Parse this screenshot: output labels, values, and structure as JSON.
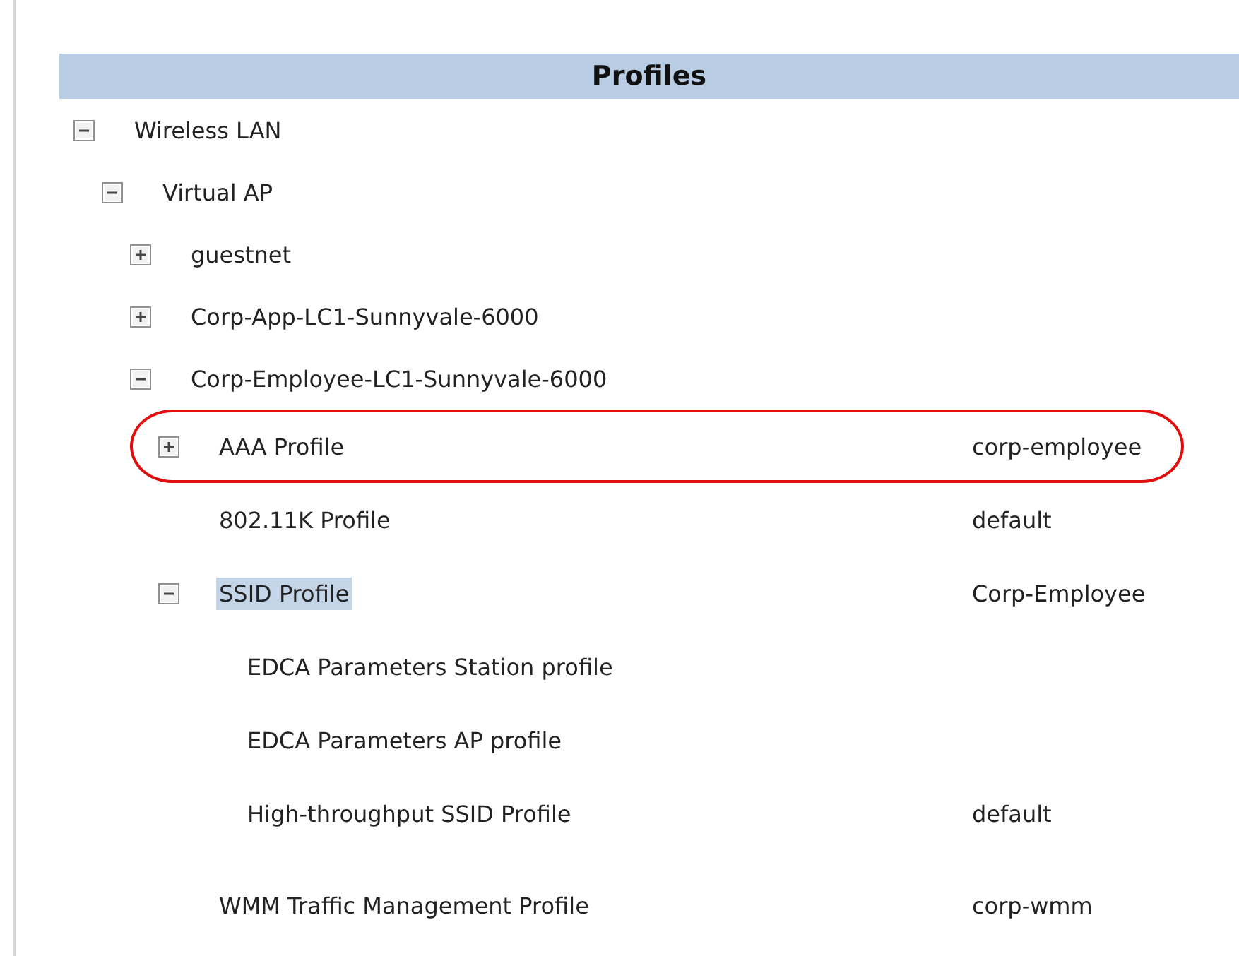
{
  "panel": {
    "title": "Profiles"
  },
  "tree": [
    {
      "label": "Wireless LAN",
      "expanded": true,
      "children": [
        {
          "label": "Virtual AP",
          "expanded": true,
          "children": [
            {
              "label": "guestnet",
              "expanded": false
            },
            {
              "label": "Corp-App-LC1-Sunnyvale-6000",
              "expanded": false
            },
            {
              "label": "Corp-Employee-LC1-Sunnyvale-6000",
              "expanded": true,
              "children": [
                {
                  "label": "AAA Profile",
                  "value": "corp-employee",
                  "expanded": false,
                  "circled": true,
                  "selected": false
                },
                {
                  "label": "802.11K Profile",
                  "value": "default",
                  "selected": false
                },
                {
                  "label": "SSID Profile",
                  "value": "Corp-Employee",
                  "expanded": true,
                  "selected": true,
                  "children": [
                    {
                      "label": "EDCA Parameters Station profile",
                      "selected": false
                    },
                    {
                      "label": "EDCA Parameters AP profile",
                      "selected": false
                    },
                    {
                      "label": "High-throughput SSID Profile",
                      "value": "default",
                      "selected": false
                    }
                  ]
                },
                {
                  "label": "WMM Traffic Management Profile",
                  "value": "corp-wmm",
                  "selected": false
                }
              ]
            }
          ]
        }
      ]
    }
  ]
}
